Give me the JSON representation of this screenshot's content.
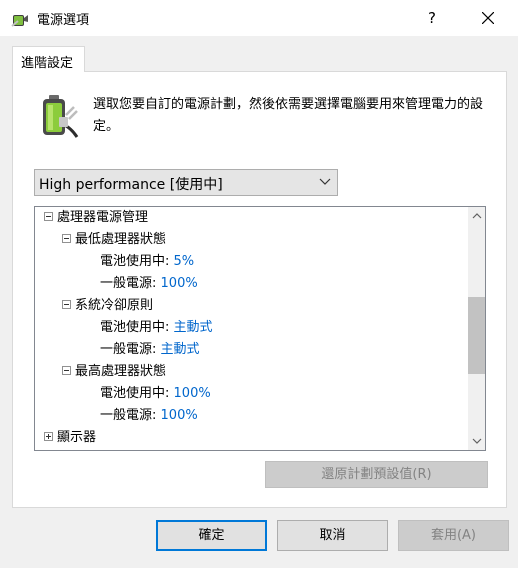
{
  "window": {
    "title": "電源選項",
    "help_label": "?",
    "icon": "power-options-icon"
  },
  "tab": {
    "label": "進階設定"
  },
  "description": "選取您要自訂的電源計劃，然後依需要選擇電腦要用來管理電力的設定。",
  "plan_select": {
    "value": "High performance [使用中]"
  },
  "tree": {
    "processor": {
      "label": "處理器電源管理",
      "min_state": {
        "label": "最低處理器狀態",
        "battery_label": "電池使用中:",
        "battery_value": "5%",
        "ac_label": "一般電源:",
        "ac_value": "100%"
      },
      "cooling": {
        "label": "系統冷卻原則",
        "battery_label": "電池使用中:",
        "battery_value": "主動式",
        "ac_label": "一般電源:",
        "ac_value": "主動式"
      },
      "max_state": {
        "label": "最高處理器狀態",
        "battery_label": "電池使用中:",
        "battery_value": "100%",
        "ac_label": "一般電源:",
        "ac_value": "100%"
      }
    },
    "display": {
      "label": "顯示器"
    }
  },
  "restore_button": "還原計劃預設值(R)",
  "buttons": {
    "ok": "確定",
    "cancel": "取消",
    "apply": "套用(A)"
  },
  "colors": {
    "value_text": "#0066cc",
    "focus_border": "#0078d7"
  }
}
